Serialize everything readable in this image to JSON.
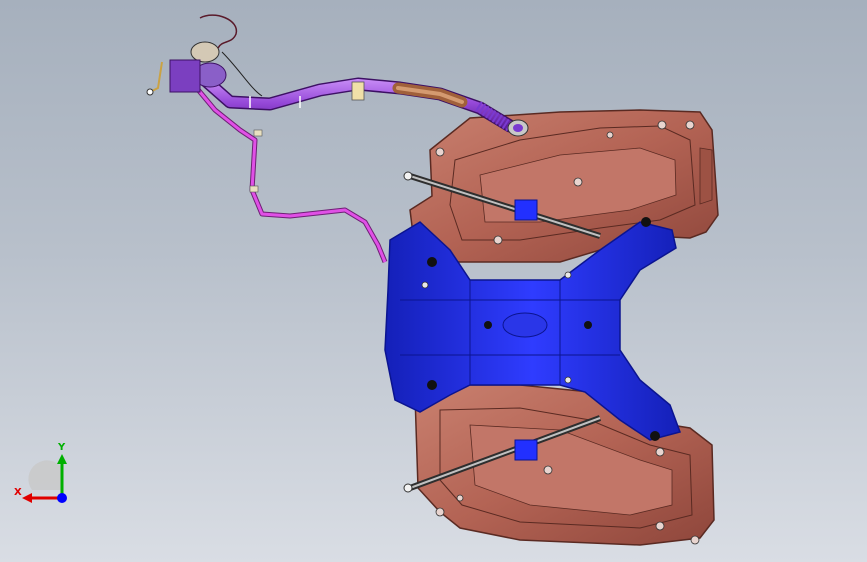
{
  "viewport": {
    "name": "3d-model-viewport"
  },
  "triad": {
    "x_label": "X",
    "y_label": "Y",
    "x_color": "#e00000",
    "y_color": "#00b000",
    "z_color": "#0000ff"
  },
  "colors": {
    "tank_shell": "#b76a5c",
    "tank_shell_dark": "#8c4438",
    "tank_edge": "#5a2a22",
    "strap_frame": "#1f2bd9",
    "strap_frame_dark": "#0b1490",
    "filler_pipe": "#9a4ee0",
    "vent_line": "#e040e0",
    "strap_rod": "#606060"
  }
}
